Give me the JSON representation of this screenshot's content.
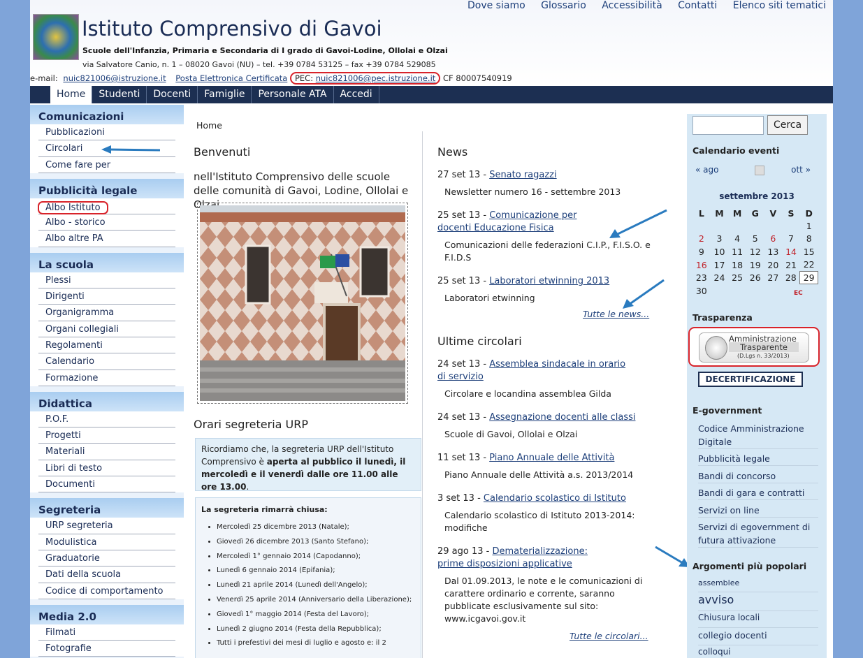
{
  "top_links": [
    "Dove siamo",
    "Glossario",
    "Accessibilità",
    "Contatti",
    "Elenco siti tematici"
  ],
  "header": {
    "title": "Istituto Comprensivo di Gavoi",
    "subtitle": "Scuole dell'Infanzia, Primaria e Secondaria di I grado di Gavoi-Lodine, Ollolai e Olzai",
    "address": "via Salvatore Canio, n. 1 – 08020 Gavoi (NU) – tel. +39 0784 53125 – fax +39 0784 529085",
    "email_label": "e-mail:",
    "email": "nuic821006@istruzione.it",
    "pec_link": "Posta Elettronica Certificata",
    "pec_label": "PEC:",
    "pec_email": "nuic821006@pec.istruzione.it",
    "cf": "CF 80007540919"
  },
  "nav": [
    "Home",
    "Studenti",
    "Docenti",
    "Famiglie",
    "Personale ATA",
    "Accedi"
  ],
  "sidebar": [
    {
      "title": "Comunicazioni",
      "items": [
        "Pubblicazioni",
        "Circolari",
        "Come fare per"
      ]
    },
    {
      "title": "Pubblicità legale",
      "items": [
        "Albo Istituto",
        "Albo - storico",
        "Albo altre PA"
      ]
    },
    {
      "title": "La scuola",
      "items": [
        "Plessi",
        "Dirigenti",
        "Organigramma",
        "Organi collegiali",
        "Regolamenti",
        "Calendario",
        "Formazione"
      ]
    },
    {
      "title": "Didattica",
      "items": [
        "P.O.F.",
        "Progetti",
        "Materiali",
        "Libri di testo",
        "Documenti"
      ]
    },
    {
      "title": "Segreteria",
      "items": [
        "URP segreteria",
        "Modulistica",
        "Graduatorie",
        "Dati della scuola",
        "Codice di comportamento"
      ]
    },
    {
      "title": "Media 2.0",
      "items": [
        "Filmati",
        "Fotografie"
      ]
    }
  ],
  "main": {
    "breadcrumb": "Home",
    "welcome_title": "Benvenuti",
    "welcome_text": "nell'Istituto Comprensivo delle scuole delle comunità di Gavoi, Lodine, Ollolai e Olzai",
    "urp_title": "Orari segreteria URP",
    "urp_text_1": "Ricordiamo che, la segreteria URP dell'Istituto Comprensivo è ",
    "urp_text_bold": "aperta al pubblico il lunedì, il mercoledì e il venerdì dalle ore 11.00 alle ore 13.00",
    "urp_text_2": ".",
    "closed_title": "La segreteria rimarrà chiusa:",
    "closed_days": [
      "Mercoledì 25 dicembre 2013 (Natale);",
      "Giovedì 26 dicembre 2013 (Santo Stefano);",
      "Mercoledì 1° gennaio 2014 (Capodanno);",
      "Lunedì 6 gennaio 2014 (Epifania);",
      "Lunedì 21 aprile 2014 (Lunedì dell'Angelo);",
      "Venerdì 25 aprile 2014 (Anniversario della Liberazione);",
      "Giovedì 1° maggio 2014 (Festa del Lavoro);",
      "Lunedì 2 giugno 2014 (Festa della Repubblica);",
      "Tutti i prefestivi dei mesi di luglio e agosto e: il 2"
    ]
  },
  "news": {
    "title": "News",
    "items": [
      {
        "date": "27 set 13 - ",
        "title": "Senato ragazzi",
        "summary": "Newsletter numero 16 - settembre 2013"
      },
      {
        "date": "25 set 13 - ",
        "title": "Comunicazione per docenti Educazione Fisica",
        "summary": "Comunicazioni delle federazioni C.I.P., F.I.S.O. e F.I.D.S"
      },
      {
        "date": "25 set 13 - ",
        "title": "Laboratori etwinning 2013",
        "summary": "Laboratori etwinning"
      }
    ],
    "more": "Tutte le news..."
  },
  "circolari": {
    "title": "Ultime circolari",
    "items": [
      {
        "date": "24 set 13 - ",
        "title": "Assemblea sindacale in orario di servizio",
        "summary": "Circolare e locandina assemblea Gilda"
      },
      {
        "date": "24 set 13 - ",
        "title": "Assegnazione docenti alle classi",
        "summary": "Scuole di Gavoi, Ollolai e Olzai"
      },
      {
        "date": "11 set 13 - ",
        "title": "Piano Annuale delle Attività",
        "summary": "Piano Annuale delle Attività a.s. 2013/2014"
      },
      {
        "date": "3 set 13 - ",
        "title": "Calendario scolastico di Istituto",
        "summary": "Calendario scolastico di Istituto 2013-2014: modifiche"
      },
      {
        "date": "29 ago 13 - ",
        "title": "Dematerializzazione: prime disposizioni applicative",
        "summary": "Dal 01.09.2013, le note e le comunicazioni di carattere ordinario e corrente, saranno pubblicate esclusivamente sul sito: www.icgavoi.gov.it"
      }
    ],
    "more": "Tutte le circolari..."
  },
  "right": {
    "search_button": "Cerca",
    "calendar_title": "Calendario eventi",
    "prev": "« ago",
    "next": "ott »",
    "month": "settembre 2013",
    "weekdays": [
      "L",
      "M",
      "M",
      "G",
      "V",
      "S",
      "D"
    ],
    "weeks": [
      [
        "",
        "",
        "",
        "",
        "",
        "",
        "1"
      ],
      [
        "2",
        "3",
        "4",
        "5",
        "6",
        "7",
        "8"
      ],
      [
        "9",
        "10",
        "11",
        "12",
        "13",
        "14",
        "15"
      ],
      [
        "16",
        "17",
        "18",
        "19",
        "20",
        "21",
        "22"
      ],
      [
        "23",
        "24",
        "25",
        "26",
        "27",
        "28",
        "29"
      ],
      [
        "30",
        "",
        "",
        "",
        "",
        "",
        ""
      ]
    ],
    "ec": "EC",
    "trasparenza_title": "Trasparenza",
    "amm_line1": "Amministrazione",
    "amm_line2": "Trasparente",
    "amm_line3": "(D.Lgs n. 33/2013)",
    "decert": "DECERTIFICAZIONE",
    "egov_title": "E-government",
    "egov_links": [
      "Codice Amministrazione Digitale",
      "Pubblicità legale",
      "Bandi di concorso",
      "Bandi di gara e contratti",
      "Servizi on line",
      "Servizi di egovernment di futura attivazione"
    ],
    "topics_title": "Argomenti più popolari",
    "topics": [
      "assemblee",
      "avviso",
      "Chiusura locali",
      "collegio docenti",
      "colloqui"
    ]
  },
  "colors": {
    "navy": "#1c2f52",
    "link": "#1d3f7a",
    "highlight": "#d8232a",
    "arrow": "#2a7bbf"
  }
}
